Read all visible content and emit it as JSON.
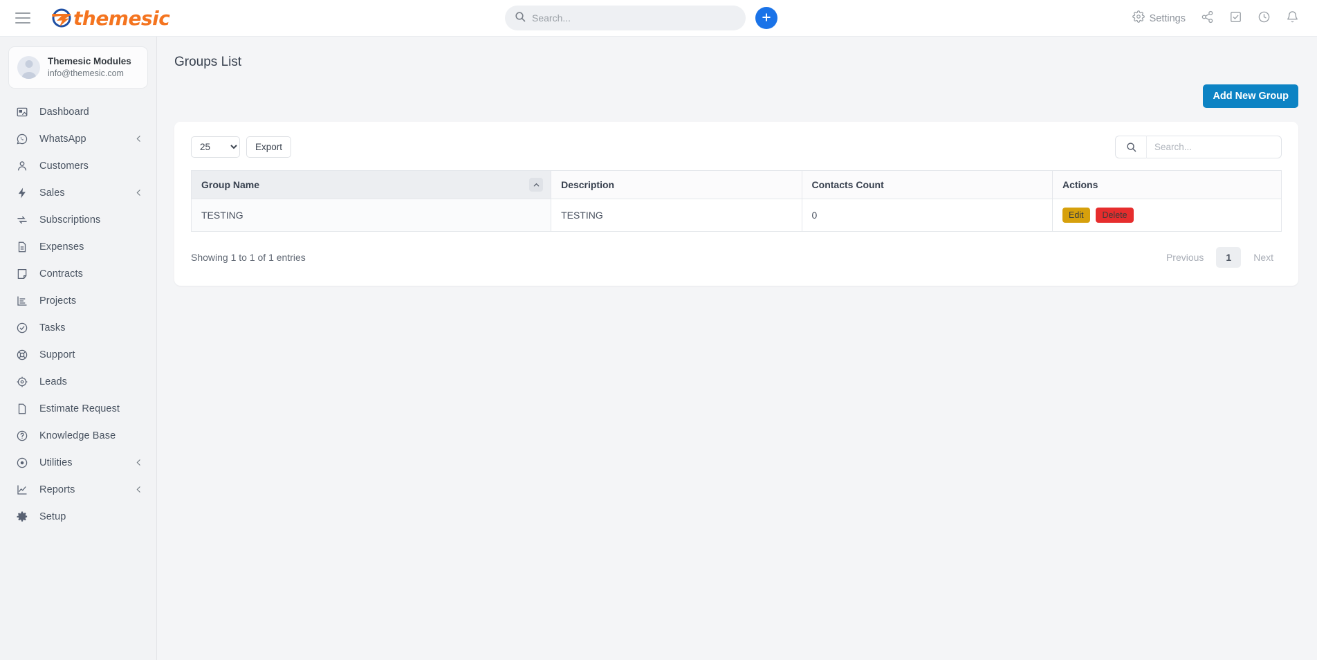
{
  "topbar": {
    "menu_icon": "hamburger-icon",
    "brand_text": "themesic",
    "search": {
      "placeholder": "Search...",
      "value": "",
      "icon": "search-icon"
    },
    "add_button_icon": "plus-icon",
    "right_items": [
      {
        "label": "Settings",
        "icon": "gear-icon"
      },
      {
        "label": "",
        "icon": "share-icon"
      },
      {
        "label": "",
        "icon": "check-square-icon"
      },
      {
        "label": "",
        "icon": "clock-icon"
      },
      {
        "label": "",
        "icon": "bell-icon"
      }
    ]
  },
  "sidebar": {
    "profile": {
      "name": "Themesic Modules",
      "email": "info@themesic.com",
      "avatar": "avatar-icon"
    },
    "items": [
      {
        "label": "Dashboard",
        "icon": "dashboard-icon",
        "expandable": false
      },
      {
        "label": "WhatsApp",
        "icon": "whatsapp-icon",
        "expandable": true
      },
      {
        "label": "Customers",
        "icon": "user-icon",
        "expandable": false
      },
      {
        "label": "Sales",
        "icon": "bolt-icon",
        "expandable": true
      },
      {
        "label": "Subscriptions",
        "icon": "repeat-icon",
        "expandable": false
      },
      {
        "label": "Expenses",
        "icon": "file-text-icon",
        "expandable": false
      },
      {
        "label": "Contracts",
        "icon": "note-icon",
        "expandable": false
      },
      {
        "label": "Projects",
        "icon": "projects-icon",
        "expandable": false
      },
      {
        "label": "Tasks",
        "icon": "check-circle-icon",
        "expandable": false
      },
      {
        "label": "Support",
        "icon": "lifebuoy-icon",
        "expandable": false
      },
      {
        "label": "Leads",
        "icon": "target-icon",
        "expandable": false
      },
      {
        "label": "Estimate Request",
        "icon": "page-icon",
        "expandable": false
      },
      {
        "label": "Knowledge Base",
        "icon": "question-circle-icon",
        "expandable": false
      },
      {
        "label": "Utilities",
        "icon": "dot-circle-icon",
        "expandable": true
      },
      {
        "label": "Reports",
        "icon": "chart-line-icon",
        "expandable": true
      },
      {
        "label": "Setup",
        "icon": "cog-icon",
        "expandable": false
      }
    ]
  },
  "main": {
    "page_title": "Groups List",
    "add_new_group_label": "Add New Group",
    "toolbar": {
      "page_length_value": "25",
      "page_length_options": [
        "25"
      ],
      "export_label": "Export",
      "search_placeholder": "Search...",
      "search_value": "",
      "search_icon": "search-icon"
    },
    "table": {
      "columns": [
        {
          "label": "Group Name",
          "sorted": "asc"
        },
        {
          "label": "Description",
          "sorted": ""
        },
        {
          "label": "Contacts Count",
          "sorted": ""
        },
        {
          "label": "Actions",
          "sorted": ""
        }
      ],
      "rows": [
        {
          "group_name": "TESTING",
          "description": "TESTING",
          "contacts_count": "0",
          "edit_label": "Edit",
          "delete_label": "Delete"
        }
      ]
    },
    "footer": {
      "entries_info": "Showing 1 to 1 of 1 entries",
      "previous_label": "Previous",
      "current_page": "1",
      "next_label": "Next"
    }
  },
  "colors": {
    "brand_orange": "#f4741f",
    "brand_blue": "#1f4fa3",
    "primary_button": "#0c83c4",
    "add_button": "#1a73e8",
    "edit_button": "#d6a00c",
    "delete_button": "#e62d2d"
  }
}
